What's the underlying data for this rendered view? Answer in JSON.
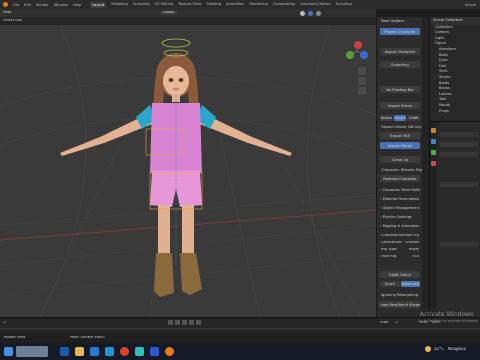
{
  "menu": {
    "workspaces": [
      "Layout",
      "Modeling",
      "Sculpting",
      "UV Editing",
      "Texture Paint",
      "Shading",
      "Animation",
      "Rendering",
      "Compositing",
      "Geometry Nodes",
      "Scripting"
    ],
    "active_workspace": "Layout"
  },
  "viewport": {
    "mode": "Pose",
    "select_box": "Select Box",
    "orientation": "Global"
  },
  "npanel": {
    "pose_options": "Pose Options",
    "project_character": "Project Character",
    "import_character": "Import Character",
    "exporting": "Exporting",
    "no_floating_bar": "No Floating Bar",
    "import_scene": "Import Scene",
    "tabs": [
      "Action",
      "Shape",
      "Cloth"
    ],
    "active_tab": "Shape",
    "export_note": "Prepare Deform: NBI only",
    "export_fbx": "Export FBX",
    "import_morph": "Import Morph",
    "clean_up": "Clean Up",
    "character_label": "Character: Blender Rig",
    "remove_character": "Remove Character",
    "sections": [
      "Character Build Settings",
      "Material Parameters",
      "Object Management",
      "Physics Settings",
      "Rigging & Animation"
    ],
    "info": [
      {
        "k": "Character:",
        "v": "Blender Rig"
      },
      {
        "k": "Generation:",
        "v": "G9Male"
      },
      {
        "k": "Rig Type:",
        "v": "Rigify"
      },
      {
        "k": "Face Rig:",
        "v": "FLB"
      }
    ],
    "rigify_setup": "Rigify Setup",
    "quick": "Quick",
    "advanced": "Advanced",
    "ignore_retargeting": "Ignoring Retargeting",
    "load_bone_shape": "Load Rest/Bend Shape"
  },
  "outliner": {
    "header": "Scene Collection",
    "items": [
      "Collection",
      "Camera",
      "Light",
      "Figure",
      "Armature",
      "Body",
      "Eyes",
      "Hair",
      "Shirt",
      "Shorts",
      "Boots",
      "Brows",
      "Lashes",
      "Tear",
      "Mouth",
      "Props"
    ]
  },
  "timeline": {
    "frame": "1",
    "start_label": "Start",
    "start": "1",
    "end_label": "End",
    "end": "250"
  },
  "status": {
    "left": "Rotate View",
    "middle": "Pose Context Menu"
  },
  "windows_watermark": {
    "line1": "Activate Windows",
    "line2": "Go to Settings to activate Windows."
  },
  "taskbar": {
    "temperature": "22°C",
    "weather": "Nuageux"
  },
  "colors": {
    "accent_blue": "#4772b3",
    "viewport_bg": "#3a3a3a",
    "selection_orange": "#e8a33a"
  }
}
